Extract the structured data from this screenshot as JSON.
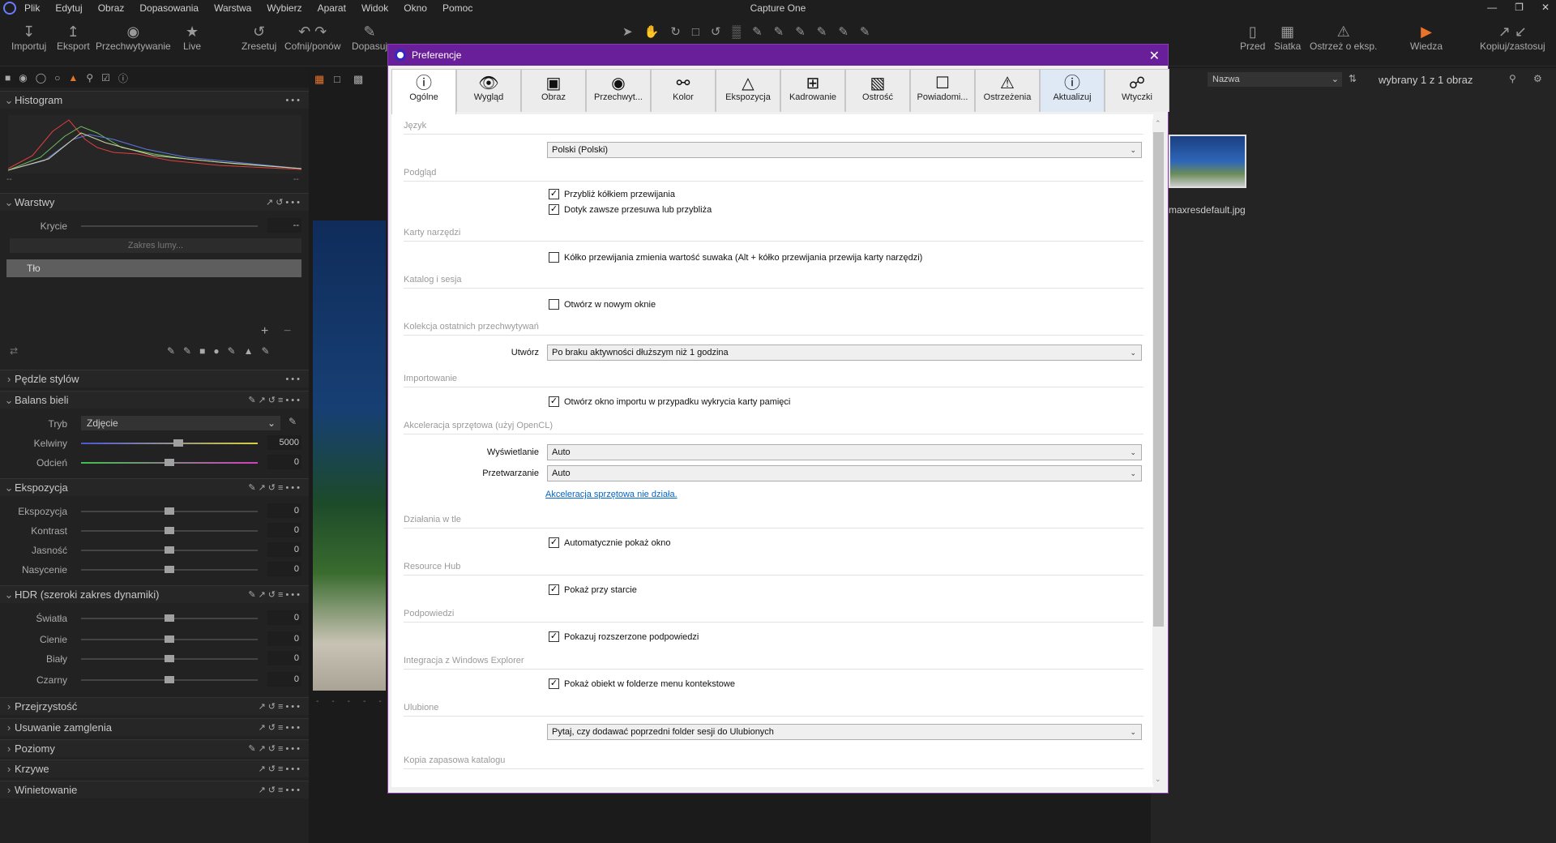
{
  "app": {
    "title": "Capture One"
  },
  "menu": [
    "Plik",
    "Edytuj",
    "Obraz",
    "Dopasowania",
    "Warstwa",
    "Wybierz",
    "Aparat",
    "Widok",
    "Okno",
    "Pomoc"
  ],
  "toolbar": {
    "left": [
      {
        "label": "Importuj",
        "icon": "import-icon"
      },
      {
        "label": "Eksport",
        "icon": "export-icon"
      },
      {
        "label": "Przechwytywanie",
        "icon": "camera-icon"
      },
      {
        "label": "Live",
        "icon": "live-icon"
      },
      {
        "label": "Zresetuj",
        "icon": "reset-icon"
      },
      {
        "label": "Cofnij/ponów",
        "icon": "undo-icon"
      },
      {
        "label": "Dopasuj",
        "icon": "adjust-icon"
      }
    ],
    "right": [
      {
        "label": "Przed"
      },
      {
        "label": "Siatka"
      },
      {
        "label": "Ostrzeż o eksp."
      },
      {
        "label": "Wiedza"
      },
      {
        "label": "Kopiuj/zastosuj"
      }
    ]
  },
  "left_panel": {
    "histogram": {
      "title": "Histogram",
      "left_value": "--",
      "right_value": "--"
    },
    "layers": {
      "title": "Warstwy",
      "opacity_label": "Krycie",
      "opacity_value": "--",
      "range_button": "Zakres lumy...",
      "layer_name": "Tło"
    },
    "styles": {
      "title": "Pędzle stylów"
    },
    "white_balance": {
      "title": "Balans bieli",
      "mode_label": "Tryb",
      "mode_value": "Zdjęcie",
      "kelvin_label": "Kelwiny",
      "kelvin_value": "5000",
      "tint_label": "Odcień",
      "tint_value": "0"
    },
    "exposure": {
      "title": "Ekspozycja",
      "rows": [
        {
          "label": "Ekspozycja",
          "value": "0"
        },
        {
          "label": "Kontrast",
          "value": "0"
        },
        {
          "label": "Jasność",
          "value": "0"
        },
        {
          "label": "Nasycenie",
          "value": "0"
        }
      ]
    },
    "hdr": {
      "title": "HDR (szeroki zakres dynamiki)",
      "rows": [
        {
          "label": "Światła",
          "value": "0"
        },
        {
          "label": "Cienie",
          "value": "0"
        },
        {
          "label": "Biały",
          "value": "0"
        },
        {
          "label": "Czarny",
          "value": "0"
        }
      ]
    },
    "collapsed": [
      "Przejrzystość",
      "Usuwanie zamglenia",
      "Poziomy",
      "Krzywe",
      "Winietowanie"
    ]
  },
  "browser": {
    "sort_label": "Nazwa",
    "selection_text": "wybrany 1 z 1 obraz",
    "thumb_name": "maxresdefault.jpg"
  },
  "dialog": {
    "title": "Preferencje",
    "tabs": [
      {
        "label": "Ogólne",
        "icon": "info-icon"
      },
      {
        "label": "Wygląd",
        "icon": "eye-icon"
      },
      {
        "label": "Obraz",
        "icon": "image-icon"
      },
      {
        "label": "Przechwyt...",
        "icon": "camera-icon"
      },
      {
        "label": "Kolor",
        "icon": "color-icon"
      },
      {
        "label": "Ekspozycja",
        "icon": "exposure-icon"
      },
      {
        "label": "Kadrowanie",
        "icon": "crop-icon"
      },
      {
        "label": "Ostrość",
        "icon": "sharpness-icon"
      },
      {
        "label": "Powiadomi...",
        "icon": "notification-icon"
      },
      {
        "label": "Ostrzeżenia",
        "icon": "warning-icon"
      },
      {
        "label": "Aktualizuj",
        "icon": "update-icon"
      },
      {
        "label": "Wtyczki",
        "icon": "plugin-icon"
      }
    ],
    "sections": {
      "language": {
        "title": "Język",
        "value": "Polski (Polski)"
      },
      "preview": {
        "title": "Podgląd",
        "opt1": "Przybliż kółkiem przewijania",
        "opt2": "Dotyk zawsze przesuwa lub przybliża"
      },
      "tools": {
        "title": "Karty narzędzi",
        "opt1": "Kółko przewijania zmienia wartość suwaka (Alt + kółko przewijania przewija karty narzędzi)"
      },
      "catalog": {
        "title": "Katalog i sesja",
        "opt1": "Otwórz w nowym oknie"
      },
      "recent": {
        "title": "Kolekcja ostatnich przechwytywań",
        "create_label": "Utwórz",
        "create_value": "Po braku aktywności dłuższym niż 1 godzina"
      },
      "import": {
        "title": "Importowanie",
        "opt1": "Otwórz okno importu w przypadku wykrycia karty pamięci"
      },
      "hw": {
        "title": "Akceleracja sprzętowa (użyj OpenCL)",
        "display_label": "Wyświetlanie",
        "display_value": "Auto",
        "processing_label": "Przetwarzanie",
        "processing_value": "Auto",
        "link": "Akceleracja sprzętowa nie działa."
      },
      "background": {
        "title": "Działania w tle",
        "opt1": "Automatycznie pokaż okno"
      },
      "resource": {
        "title": "Resource Hub",
        "opt1": "Pokaż przy starcie"
      },
      "hints": {
        "title": "Podpowiedzi",
        "opt1": "Pokazuj rozszerzone podpowiedzi"
      },
      "explorer": {
        "title": "Integracja z Windows Explorer",
        "opt1": "Pokaż obiekt w folderze menu kontekstowe"
      },
      "favorites": {
        "title": "Ulubione",
        "value": "Pytaj, czy dodawać poprzedni folder sesji do Ulubionych"
      },
      "backup": {
        "title": "Kopia zapasowa katalogu"
      }
    }
  }
}
